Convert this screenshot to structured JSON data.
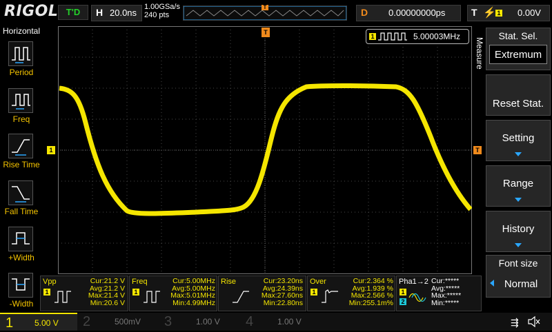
{
  "header": {
    "logo": "RIGOL",
    "run_status": "T'D",
    "horizontal_key": "H",
    "timebase": "20.0ns",
    "sample_rate": "1.00GSa/s",
    "memory_depth": "240  pts",
    "trigger_pos_key": "D",
    "trigger_delay": "0.00000000ps",
    "trigger_key": "T",
    "trigger_level": "0.00V",
    "trigger_channel": "1"
  },
  "left_menu": {
    "title": "Horizontal",
    "items": [
      {
        "label": "Period",
        "icon": "period-icon"
      },
      {
        "label": "Freq",
        "icon": "freq-icon"
      },
      {
        "label": "Rise Time",
        "icon": "rise-time-icon"
      },
      {
        "label": "Fall Time",
        "icon": "fall-time-icon"
      },
      {
        "label": "+Width",
        "icon": "pos-width-icon"
      },
      {
        "label": "-Width",
        "icon": "neg-width-icon"
      }
    ]
  },
  "right_menu": {
    "side_label": "Measure",
    "items": [
      {
        "title": "Stat. Sel.",
        "value": "Extremum"
      },
      {
        "title": "",
        "value": "Reset Stat."
      },
      {
        "title": "",
        "value": "Setting",
        "arrow": true
      },
      {
        "title": "",
        "value": "Range",
        "arrow": true
      },
      {
        "title": "",
        "value": "History",
        "arrow": true
      },
      {
        "title": "Font size",
        "value": "Normal"
      }
    ]
  },
  "freq_counter": {
    "channel": "1",
    "value": "5.00003MHz"
  },
  "measurements": [
    {
      "name": "Vpp",
      "cur": "Cur:21.2 V",
      "avg": "Avg:21.2 V",
      "max": "Max:21.4 V",
      "min": "Min:20.6 V"
    },
    {
      "name": "Freq",
      "cur": "Cur:5.00MHz",
      "avg": "Avg:5.00MHz",
      "max": "Max:5.01MHz",
      "min": "Min:4.99MHz"
    },
    {
      "name": "Rise",
      "cur": "Cur:23.20ns",
      "avg": "Avg:24.39ns",
      "max": "Max:27.60ns",
      "min": "Min:22.80ns"
    },
    {
      "name": "Over",
      "cur": "Cur:2.364 %",
      "avg": "Avg:1.939 %",
      "max": "Max:2.566 %",
      "min": "Min:255.1m%"
    },
    {
      "name": "Pha1→2",
      "cur": "Cur:*****",
      "avg": "Avg:*****",
      "max": "Max:*****",
      "min": "Min:*****"
    }
  ],
  "channels": [
    {
      "num": "1",
      "scale": "5.00 V",
      "color": "#f5e600",
      "active": true
    },
    {
      "num": "2",
      "scale": "500mV",
      "color": "#1ec7d8",
      "active": false
    },
    {
      "num": "3",
      "scale": "1.00 V",
      "color": "#e040c0",
      "active": false
    },
    {
      "num": "4",
      "scale": "1.00 V",
      "color": "#2a7fe8",
      "active": false
    }
  ],
  "colors": {
    "ch1": "#f5e600",
    "accent": "#2aa7ff",
    "trigger": "#f08a1c",
    "status": "#24d02a"
  }
}
